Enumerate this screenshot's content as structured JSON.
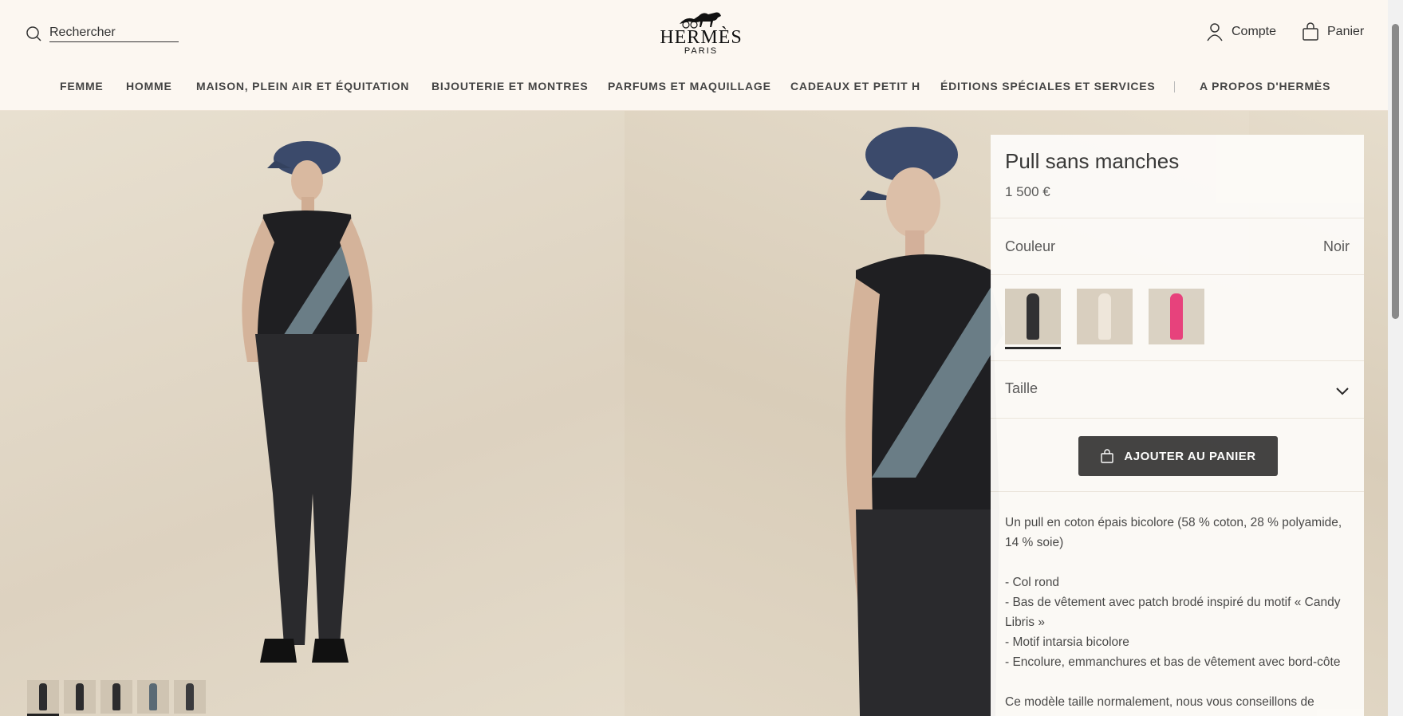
{
  "header": {
    "search_label": "Rechercher",
    "logo_name": "HERMÈS",
    "logo_city": "PARIS",
    "account_label": "Compte",
    "cart_label": "Panier"
  },
  "nav": {
    "items": [
      "FEMME",
      "HOMME",
      "MAISON, PLEIN AIR ET ÉQUITATION",
      "BIJOUTERIE ET MONTRES",
      "PARFUMS ET MAQUILLAGE",
      "CADEAUX ET PETIT H",
      "ÉDITIONS SPÉCIALES ET SERVICES",
      "A PROPOS D'HERMÈS"
    ]
  },
  "product": {
    "title": "Pull sans manches",
    "price": "1 500 €",
    "color_label": "Couleur",
    "color_value": "Noir",
    "size_label": "Taille",
    "add_to_cart": "AJOUTER AU PANIER",
    "swatch_colors": [
      "#2b2b2e",
      "#efe7dc",
      "#e83d7a"
    ],
    "description": [
      "Un pull en coton épais bicolore (58 % coton, 28 % polyamide, 14 % soie)",
      "",
      "- Col rond",
      "- Bas de vêtement avec patch brodé inspiré du motif « Candy Libris »",
      "- Motif intarsia bicolore",
      "- Encolure, emmanchures et bas de vêtement avec bord-côte",
      "",
      "Ce modèle taille normalement, nous vous conseillons de"
    ]
  },
  "gallery": {
    "thumbnail_count": 5,
    "active_thumbnail": 1
  },
  "colors": {
    "background": "#fcf7f1",
    "button": "#3e3e3e",
    "text": "#444444"
  }
}
